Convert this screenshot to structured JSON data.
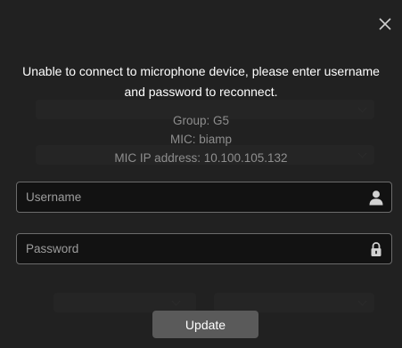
{
  "dialog": {
    "message": "Unable to connect to microphone device, please enter username and password to reconnect.",
    "group_line": "Group: G5",
    "mic_line": "MIC: biamp",
    "ip_line": "MIC IP address: 10.100.105.132",
    "close_icon": "close-icon",
    "username": {
      "placeholder": "Username",
      "value": "",
      "icon": "user-icon"
    },
    "password": {
      "placeholder": "Password",
      "value": "",
      "icon": "lock-icon"
    },
    "update_label": "Update"
  },
  "colors": {
    "overlay": "#3c3c3c",
    "field_bg": "#121212",
    "field_border": "#6c6c6c",
    "button_bg": "#5a5a5a",
    "text_primary": "#ffffff",
    "text_muted": "#8e8e8e"
  }
}
